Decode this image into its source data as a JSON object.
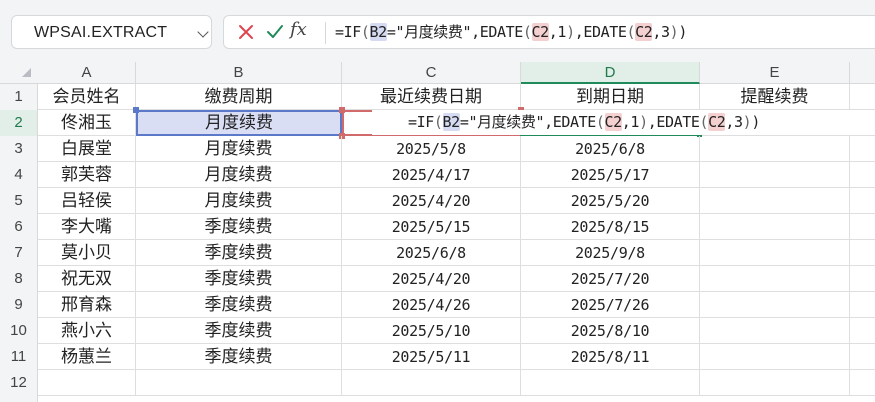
{
  "name_box": {
    "value": "WPSAI.EXTRACT"
  },
  "formula_bar": {
    "fx_label": "fx",
    "formula_parts": {
      "p1": "=IF",
      "p2": "(",
      "p3": "B2",
      "p4": "=\"月度续费\",EDATE",
      "p5": "(",
      "p6": "C2",
      "p7": ",1",
      "p8": ")",
      "p9": ",EDATE",
      "p10": "(",
      "p11": "C2",
      "p12": ",3",
      "p13": ")",
      "p14": ")"
    }
  },
  "columns": [
    "A",
    "B",
    "C",
    "D",
    "E"
  ],
  "row_numbers": [
    "1",
    "2",
    "3",
    "4",
    "5",
    "6",
    "7",
    "8",
    "9",
    "10",
    "11",
    "12"
  ],
  "headers": {
    "a": "会员姓名",
    "b": "缴费周期",
    "c": "最近续费日期",
    "d": "到期日期",
    "e": "提醒续费"
  },
  "rows": [
    {
      "a": "佟湘玉",
      "b": "月度续费",
      "c": "",
      "d": "",
      "e": ""
    },
    {
      "a": "白展堂",
      "b": "月度续费",
      "c": "2025/5/8",
      "d": "2025/6/8",
      "e": ""
    },
    {
      "a": "郭芙蓉",
      "b": "月度续费",
      "c": "2025/4/17",
      "d": "2025/5/17",
      "e": ""
    },
    {
      "a": "吕轻侯",
      "b": "月度续费",
      "c": "2025/4/20",
      "d": "2025/5/20",
      "e": ""
    },
    {
      "a": "李大嘴",
      "b": "季度续费",
      "c": "2025/5/15",
      "d": "2025/8/15",
      "e": ""
    },
    {
      "a": "莫小贝",
      "b": "季度续费",
      "c": "2025/6/8",
      "d": "2025/9/8",
      "e": ""
    },
    {
      "a": "祝无双",
      "b": "季度续费",
      "c": "2025/4/20",
      "d": "2025/7/20",
      "e": ""
    },
    {
      "a": "邢育森",
      "b": "季度续费",
      "c": "2025/4/26",
      "d": "2025/7/26",
      "e": ""
    },
    {
      "a": "燕小六",
      "b": "季度续费",
      "c": "2025/5/10",
      "d": "2025/8/10",
      "e": ""
    },
    {
      "a": "杨蕙兰",
      "b": "季度续费",
      "c": "2025/5/11",
      "d": "2025/8/11",
      "e": ""
    }
  ],
  "colors": {
    "accent_green": "#1f8a5a",
    "ref_blue": "#5b78c9",
    "ref_red": "#d16b6b",
    "cancel_red": "#e0454f"
  }
}
